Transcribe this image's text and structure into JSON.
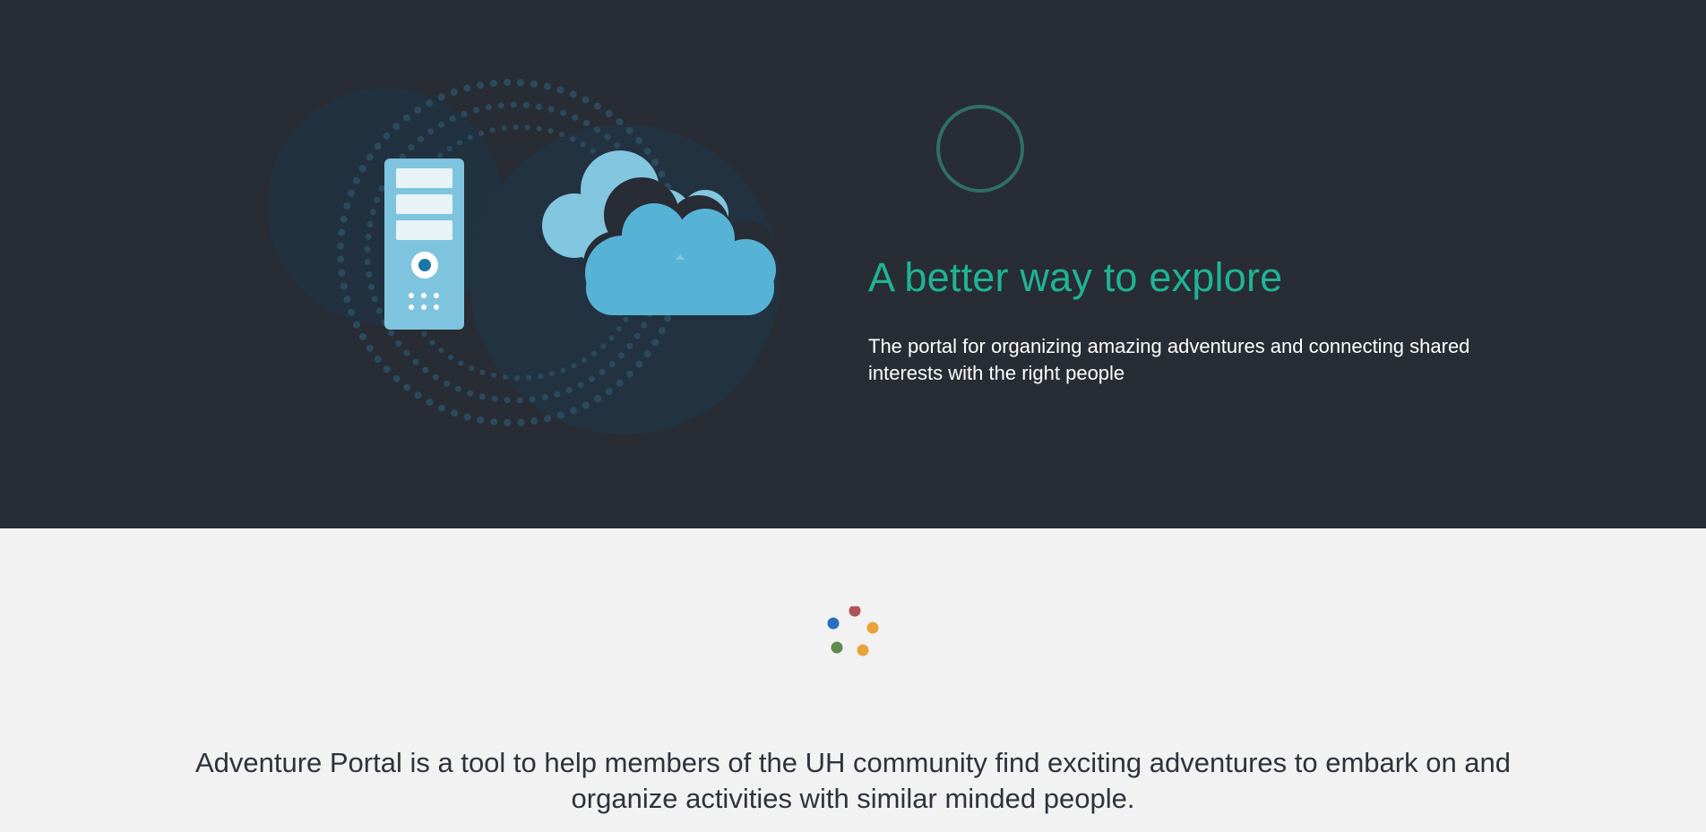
{
  "hero": {
    "title": "A better way to explore",
    "subtitle": "The portal for organizing amazing adventures and connecting shared interests with the right people",
    "illustration_icons": [
      "server-icon",
      "cloud-icon"
    ]
  },
  "about": {
    "text": "Adventure Portal is a tool to help members of the UH community find exciting adventures to embark on and organize activities with similar minded people."
  },
  "colors": {
    "hero_background": "#282c35",
    "accent": "#1fb494",
    "content_background": "#f2f2f2",
    "body_text": "#2e323c",
    "spinner_dots": [
      "#b0525a",
      "#e8a33a",
      "#e8a33a",
      "#5e8a4a",
      "#2a6fbf"
    ]
  }
}
